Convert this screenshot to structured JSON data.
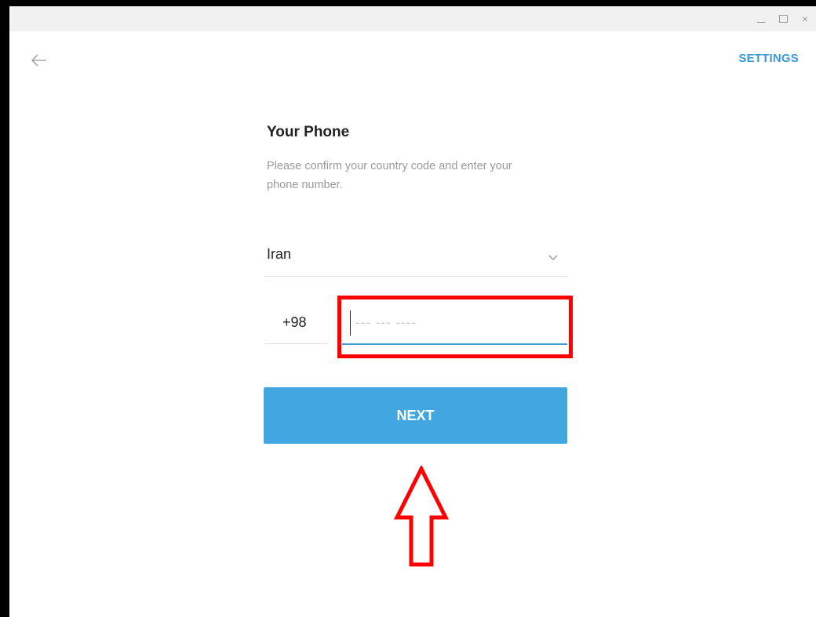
{
  "window": {
    "controls": {
      "minimize_icon": "minimize-icon",
      "maximize_icon": "maximize-icon",
      "close_glyph": "×"
    }
  },
  "header": {
    "back_icon": "arrow-left-icon",
    "settings_label": "SETTINGS"
  },
  "form": {
    "title": "Your Phone",
    "description": "Please confirm your country code and enter your phone number.",
    "country": {
      "selected": "Iran",
      "chevron_icon": "chevron-down-icon"
    },
    "country_code": "+98",
    "phone": {
      "value": "",
      "placeholder": "--- --- ----"
    },
    "next_label": "NEXT"
  },
  "annotations": {
    "highlight_color": "#ff0000",
    "arrow_icon": "arrow-up-outline-icon"
  },
  "colors": {
    "accent": "#3b98d7",
    "button": "#42a6e0",
    "annotation": "#ff0000"
  }
}
